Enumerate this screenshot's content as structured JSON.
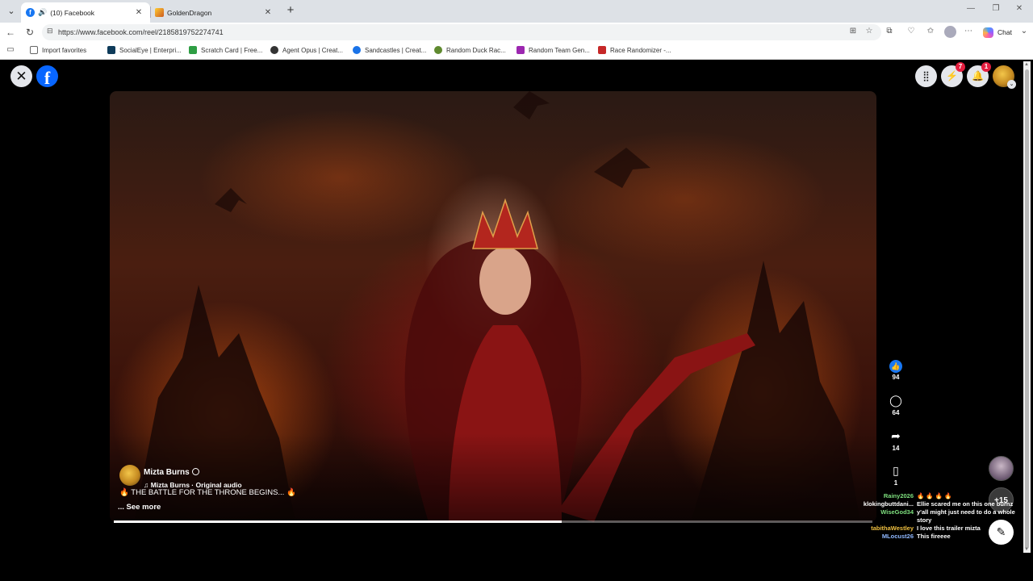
{
  "browser": {
    "tabs": [
      {
        "title": "(10) Facebook",
        "active": true
      },
      {
        "title": "GoldenDragon",
        "active": false
      }
    ],
    "address": {
      "url": "https://www.facebook.com/reel/2185819752274741"
    },
    "chat_label": "Chat",
    "bookmarks": [
      {
        "label": "Import favorites",
        "color": "#666666"
      },
      {
        "label": "SocialEye | Enterpri...",
        "color": "#0e3b5a"
      },
      {
        "label": "Scratch Card | Free...",
        "color": "#2e9e44"
      },
      {
        "label": "Agent Opus | Creat...",
        "color": "#333333"
      },
      {
        "label": "Sandcastles | Creat...",
        "color": "#1a73e8"
      },
      {
        "label": "Random Duck Rac...",
        "color": "#5f8a2f"
      },
      {
        "label": "Random Team Gen...",
        "color": "#9c27b0"
      },
      {
        "label": "Race Randomizer -...",
        "color": "#c62828"
      }
    ]
  },
  "facebook": {
    "header": {
      "messenger_badge": "7",
      "notifications_badge": "1"
    },
    "reel": {
      "author": "Mizta Burns",
      "audio": "Mizta Burns · Original audio",
      "caption": "🔥 THE BATTLE FOR THE THRONE BEGINS... 🔥",
      "see_more": "... See more",
      "progress": 0.59,
      "actions": {
        "likes": "94",
        "comments": "64",
        "shares": "14",
        "saves": "1"
      }
    },
    "viewers_more": "+15",
    "live_comments": [
      {
        "user": "Rainy2026",
        "text": "🔥 🔥 🔥 🔥",
        "color": "#7ee07e"
      },
      {
        "user": "klokingbuttdani...",
        "text": "Ellie scared me on this one burnz",
        "color": "#ffffff"
      },
      {
        "user": "WiseGod34",
        "text": "y'all might just need to do a whole story",
        "color": "#7ee07e"
      },
      {
        "user": "tabithaWestley",
        "text": "I love this trailer mizta",
        "color": "#f0c040"
      },
      {
        "user": "MLocust26",
        "text": "This fireeee",
        "color": "#8fb8ff"
      }
    ]
  }
}
